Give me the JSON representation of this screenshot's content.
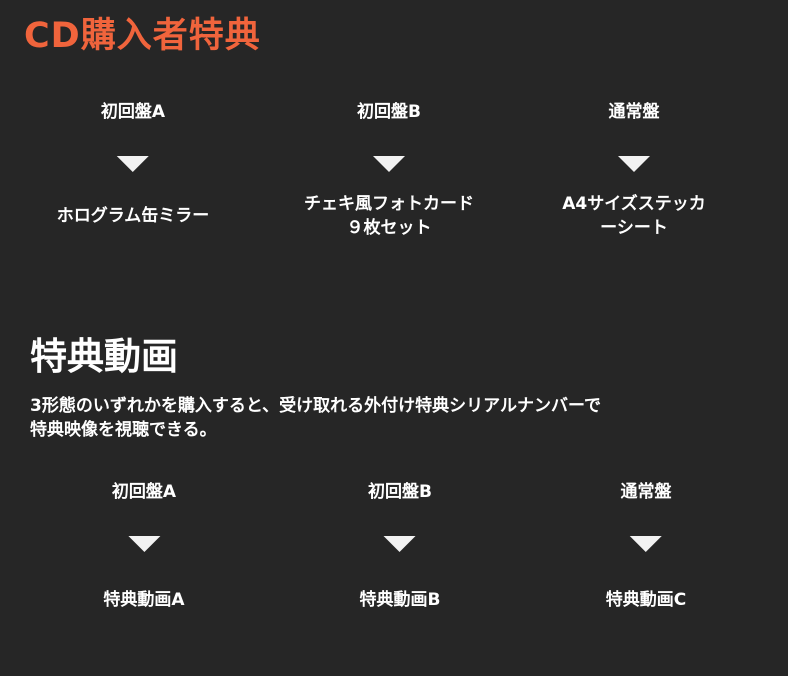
{
  "colors": {
    "background": "#262626",
    "accent": "#f0643c",
    "text": "#ffffff",
    "arrow": "#f2f2f2"
  },
  "cd_bonus": {
    "title": "CD購入者特典",
    "columns": [
      {
        "edition": "初回盤A",
        "bonus": "ホログラム缶ミラー"
      },
      {
        "edition": "初回盤B",
        "bonus": "チェキ風フォトカード\n９枚セット"
      },
      {
        "edition": "通常盤",
        "bonus": "A4サイズステッカーシート"
      }
    ]
  },
  "video_bonus": {
    "title": "特典動画",
    "description": "3形態のいずれかを購入すると、受け取れる外付け特典シリアルナンバーで\n特典映像を視聴できる。",
    "columns": [
      {
        "edition": "初回盤A",
        "bonus": "特典動画A"
      },
      {
        "edition": "初回盤B",
        "bonus": "特典動画B"
      },
      {
        "edition": "通常盤",
        "bonus": "特典動画C"
      }
    ]
  }
}
